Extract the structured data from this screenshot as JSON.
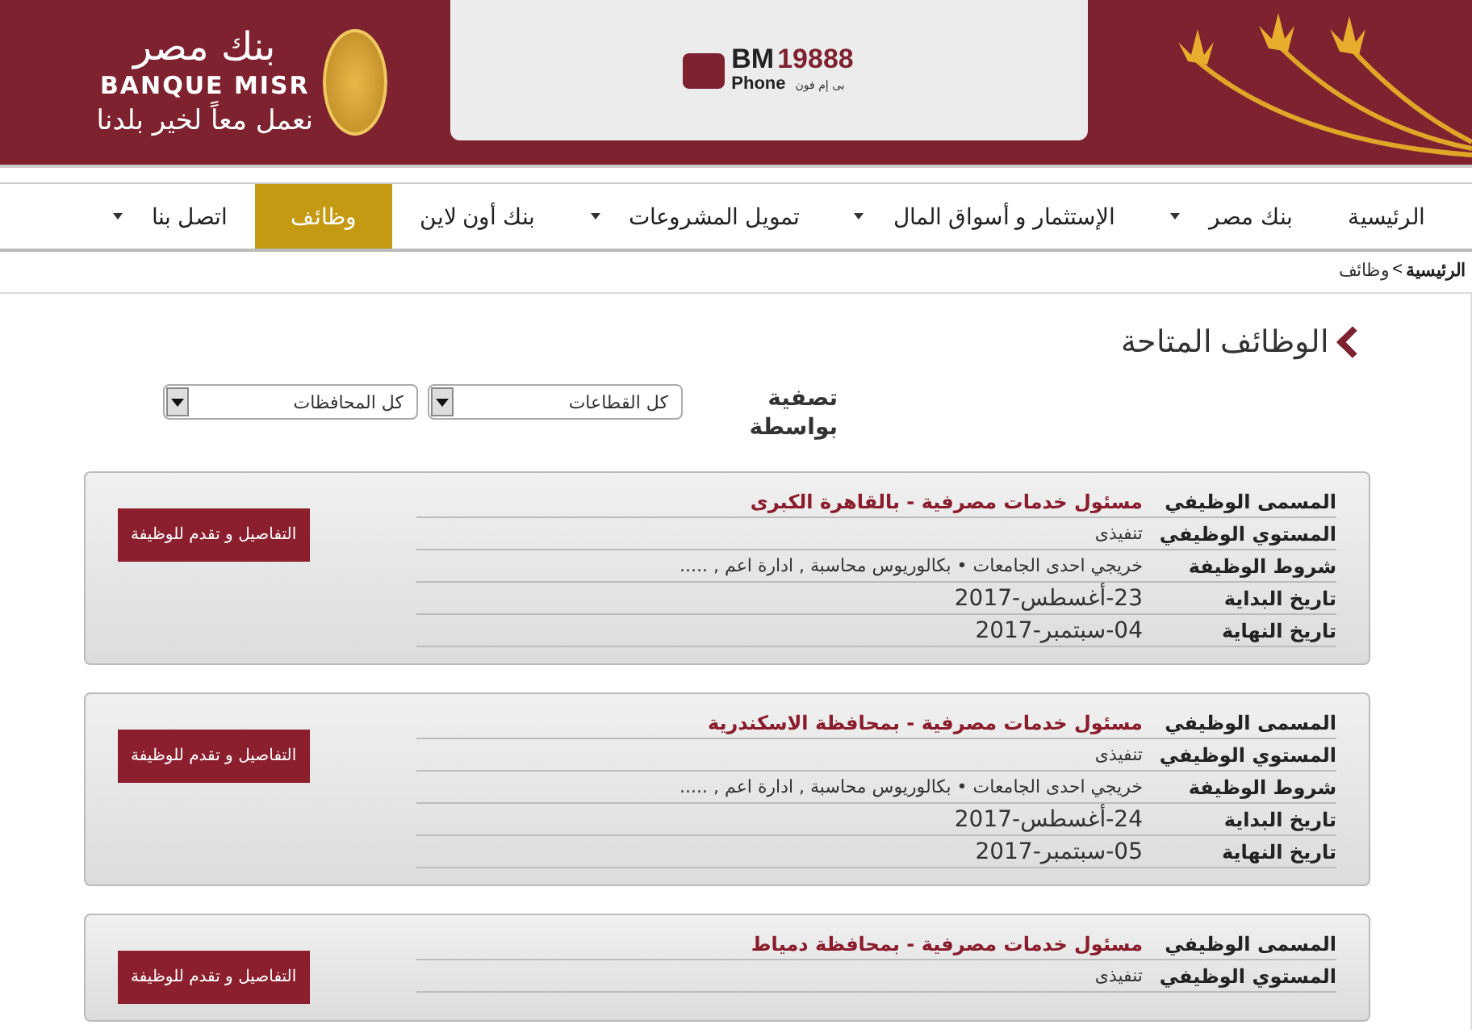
{
  "header": {
    "logo": {
      "name_ar": "بنك مصر",
      "name_en": "BANQUE MISR",
      "slogan": "نعمل معاً لخير بلدنا"
    },
    "phone_logo": {
      "brand": "BM",
      "number": "19888",
      "word": "Phone",
      "word_ar": "بى إم فون"
    }
  },
  "nav": [
    {
      "label": "الرئيسية",
      "dropdown": false,
      "selected": false
    },
    {
      "label": "بنك مصر",
      "dropdown": true,
      "selected": false
    },
    {
      "label": "الإستثمار و أسواق المال",
      "dropdown": true,
      "selected": false
    },
    {
      "label": "تمويل المشروعات",
      "dropdown": true,
      "selected": false
    },
    {
      "label": "بنك أون لاين",
      "dropdown": false,
      "selected": false
    },
    {
      "label": "وظائف",
      "dropdown": false,
      "selected": true
    },
    {
      "label": "اتصل بنا",
      "dropdown": true,
      "selected": false
    }
  ],
  "breadcrumb": {
    "home": "الرئيسية",
    "separator": ">",
    "current": "وظائف"
  },
  "page_title": "الوظائف المتاحة",
  "filter": {
    "label": "تصفية بواسطة",
    "selects": [
      {
        "value": "كل القطاعات"
      },
      {
        "value": "كل المحافظات"
      }
    ]
  },
  "jobs": [
    {
      "button": "التفاصيل و تقدم للوظيفة",
      "rows": [
        {
          "kind": "title",
          "label": "المسمى الوظيفي",
          "value": "مسئول خدمات مصرفية - بالقاهرة الكبرى"
        },
        {
          "kind": "small",
          "label": "المستوي الوظيفي",
          "value": "تنفيذى"
        },
        {
          "kind": "small",
          "label": "شروط الوظيفة",
          "value": "خريجي احدى الجامعات • بكالوريوس محاسبة , ادارة اعم , ....."
        },
        {
          "kind": "date",
          "label": "تاريخ البداية",
          "value": "23-أغسطس-2017"
        },
        {
          "kind": "date",
          "label": "تاريخ النهاية",
          "value": "04-سبتمبر-2017"
        }
      ]
    },
    {
      "button": "التفاصيل و تقدم للوظيفة",
      "rows": [
        {
          "kind": "title",
          "label": "المسمى الوظيفي",
          "value": "مسئول خدمات مصرفية - بمحافظة الاسكندرية"
        },
        {
          "kind": "small",
          "label": "المستوي الوظيفي",
          "value": "تنفيذى"
        },
        {
          "kind": "small",
          "label": "شروط الوظيفة",
          "value": "خريجي احدى الجامعات • بكالوريوس محاسبة , ادارة اعم , ....."
        },
        {
          "kind": "date",
          "label": "تاريخ البداية",
          "value": "24-أغسطس-2017"
        },
        {
          "kind": "date",
          "label": "تاريخ النهاية",
          "value": "05-سبتمبر-2017"
        }
      ]
    },
    {
      "button": "التفاصيل و تقدم للوظيفة",
      "rows": [
        {
          "kind": "title",
          "label": "المسمى الوظيفي",
          "value": "مسئول خدمات مصرفية - بمحافظة دمياط"
        },
        {
          "kind": "small",
          "label": "المستوي الوظيفي",
          "value": "تنفيذى"
        }
      ]
    }
  ]
}
